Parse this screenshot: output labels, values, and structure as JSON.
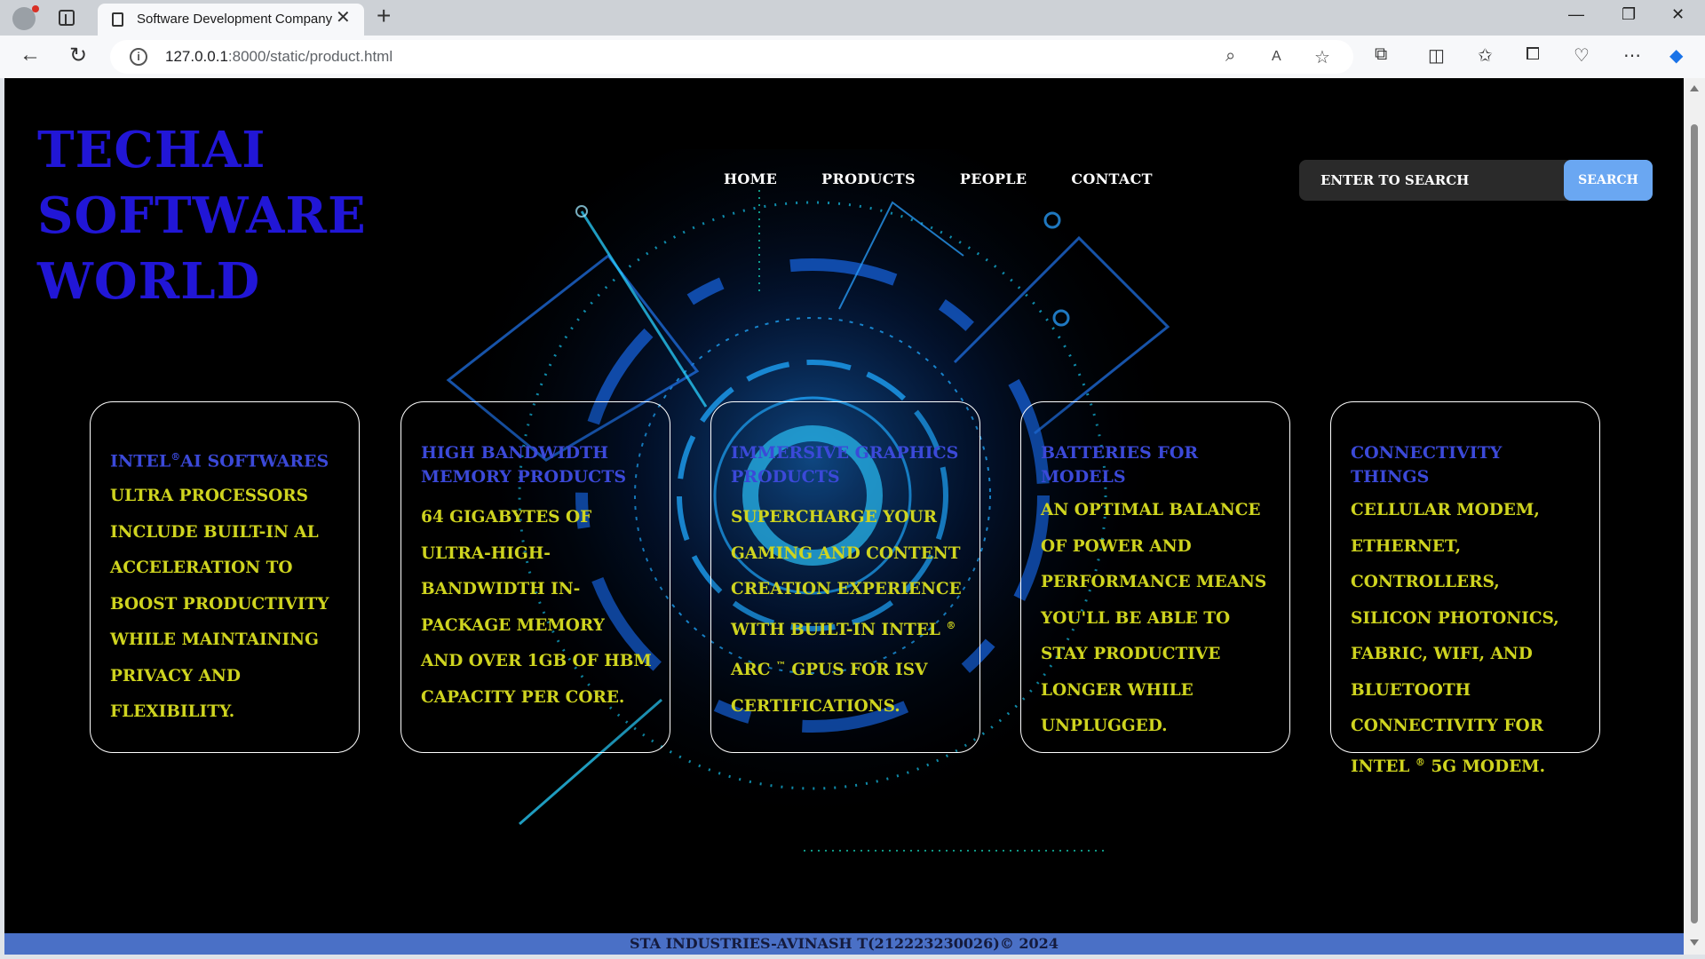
{
  "browser": {
    "tab_title": "Software Development Company",
    "tab_close": "✕",
    "new_tab": "+",
    "url_host": "127.0.0.1",
    "url_path": ":8000/static/product.html",
    "window_controls": [
      "—",
      "❐",
      "✕"
    ]
  },
  "site": {
    "logo": "Techai Software World",
    "nav": [
      "Home",
      "Products",
      "People",
      "Contact"
    ],
    "search": {
      "placeholder": "Enter to search",
      "button": "Search"
    }
  },
  "cards": [
    {
      "title_pre": "Intel",
      "title_sup": "®",
      "title_post": "AI Softwares",
      "body": "Ultra processors include built-in AL acceleration to boost productivity while maintaining privacy and flexibility."
    },
    {
      "title": "High Bandwidth Memory Products",
      "body": "64 gigabytes of ultra-high- bandwidth in-package memory and over 1GB of HBM capacity per core."
    },
    {
      "title": "Immersive Graphics Products",
      "body_pre": "Supercharge your gaming and content creation experience with built-in Intel ",
      "body_sup1": "®",
      "body_mid": " Arc ",
      "body_sup2": "™",
      "body_post": " GPUs for ISV certifications."
    },
    {
      "title": "Batteries for Models",
      "body": "An optimal balance of power and performance means you'll be able to stay productive longer while unplugged."
    },
    {
      "title": "Connectivity Things",
      "body_pre": "Cellular modem, Ethernet, controllers, silicon photonics, fabric, WiFi, and Bluetooth connectivity for Intel ",
      "body_sup": "®",
      "body_post": " 5G modem."
    }
  ],
  "footer": "STA INDUSTRIES-AVINASH T(212223230026)© 2024",
  "colors": {
    "logo": "#2116d6",
    "card_title": "#3b49d8",
    "card_body": "#cfd41f",
    "footer_bg": "#4a70c6",
    "search_btn": "#6aa7f2"
  }
}
